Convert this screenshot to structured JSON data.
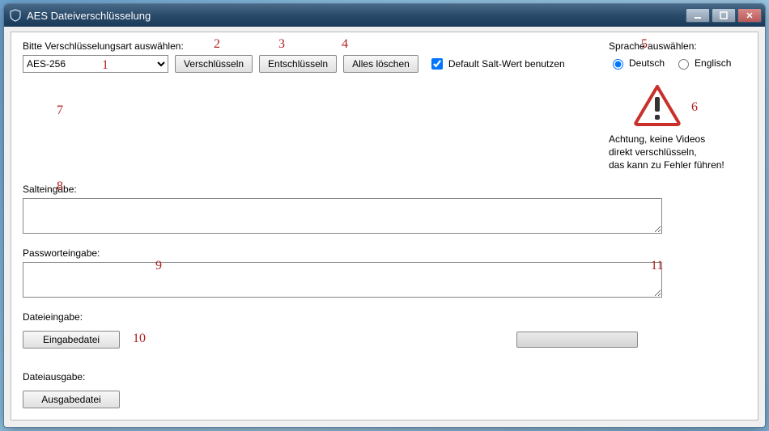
{
  "window": {
    "title": "AES Dateiverschlüsselung"
  },
  "prompt": "Bitte Verschlüsselungsart auswählen:",
  "dropdown": {
    "selected": "AES-256"
  },
  "buttons": {
    "encrypt": "Verschlüsseln",
    "decrypt": "Entschlüsseln",
    "clear": "Alles löschen"
  },
  "checkbox": {
    "default_salt": "Default Salt-Wert benutzen",
    "checked": true
  },
  "labels": {
    "salt": "Salteingabe:",
    "password": "Passworteingabe:",
    "file_in": "Dateieingabe:",
    "file_out": "Dateiausgabe:"
  },
  "file_buttons": {
    "input": "Eingabedatei",
    "output": "Ausgabedatei"
  },
  "language": {
    "heading": "Sprache auswählen:",
    "german": "Deutsch",
    "english": "Englisch",
    "selected": "german"
  },
  "warning": {
    "line1": "Achtung, keine Videos",
    "line2": "direkt verschlüsseln,",
    "line3": "das kann zu Fehler führen!"
  },
  "annotations": {
    "a1": "1",
    "a2": "2",
    "a3": "3",
    "a4": "4",
    "a5": "5",
    "a6": "6",
    "a7": "7",
    "a8": "8",
    "a9": "9",
    "a10": "10",
    "a11": "11"
  }
}
